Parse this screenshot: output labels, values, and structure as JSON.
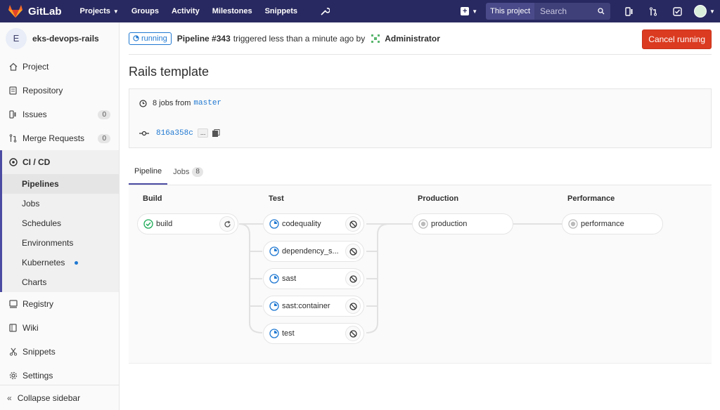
{
  "app": {
    "name": "GitLab"
  },
  "nav": {
    "links": [
      {
        "label": "Projects",
        "dropdown": true
      },
      {
        "label": "Groups"
      },
      {
        "label": "Activity"
      },
      {
        "label": "Milestones"
      },
      {
        "label": "Snippets"
      }
    ],
    "search": {
      "scope": "This project",
      "placeholder": "Search"
    }
  },
  "sidebar": {
    "project": {
      "initial": "E",
      "name": "eks-devops-rails"
    },
    "items": [
      {
        "label": "Project",
        "icon": "home-icon"
      },
      {
        "label": "Repository",
        "icon": "doc-icon"
      },
      {
        "label": "Issues",
        "icon": "issues-icon",
        "count": "0"
      },
      {
        "label": "Merge Requests",
        "icon": "merge-icon",
        "count": "0"
      }
    ],
    "cicd": {
      "label": "CI / CD",
      "subitems": [
        "Pipelines",
        "Jobs",
        "Schedules",
        "Environments",
        "Kubernetes",
        "Charts"
      ],
      "active": "Pipelines"
    },
    "lower_items": [
      {
        "label": "Registry",
        "icon": "registry-icon"
      },
      {
        "label": "Wiki",
        "icon": "book-icon"
      },
      {
        "label": "Snippets",
        "icon": "scissors-icon"
      },
      {
        "label": "Settings",
        "icon": "gear-icon"
      }
    ],
    "collapse_label": "Collapse sidebar"
  },
  "pipeline": {
    "status": "running",
    "title": "Pipeline #343",
    "trigger_text": "triggered less than a minute ago by",
    "user": "Administrator",
    "cancel_label": "Cancel running",
    "page_title": "Rails template",
    "jobs_count_text": "8 jobs from",
    "branch": "master",
    "commit": "816a358c",
    "ellipsis": "..."
  },
  "tabs": [
    {
      "label": "Pipeline",
      "active": true
    },
    {
      "label": "Jobs",
      "count": "8"
    }
  ],
  "stages": [
    {
      "name": "Build",
      "jobs": [
        {
          "name": "build",
          "status": "success",
          "action": "retry"
        }
      ]
    },
    {
      "name": "Test",
      "jobs": [
        {
          "name": "codequality",
          "status": "running",
          "action": "cancel"
        },
        {
          "name": "dependency_s...",
          "status": "running",
          "action": "cancel"
        },
        {
          "name": "sast",
          "status": "running",
          "action": "cancel"
        },
        {
          "name": "sast:container",
          "status": "running",
          "action": "cancel"
        },
        {
          "name": "test",
          "status": "running",
          "action": "cancel"
        }
      ]
    },
    {
      "name": "Production",
      "jobs": [
        {
          "name": "production",
          "status": "created"
        }
      ]
    },
    {
      "name": "Performance",
      "jobs": [
        {
          "name": "performance",
          "status": "created"
        }
      ]
    }
  ],
  "colors": {
    "navbar": "#292961",
    "accent": "#4b4ba3",
    "success": "#1aaa55",
    "running": "#1f78d1",
    "danger": "#db3b21"
  }
}
